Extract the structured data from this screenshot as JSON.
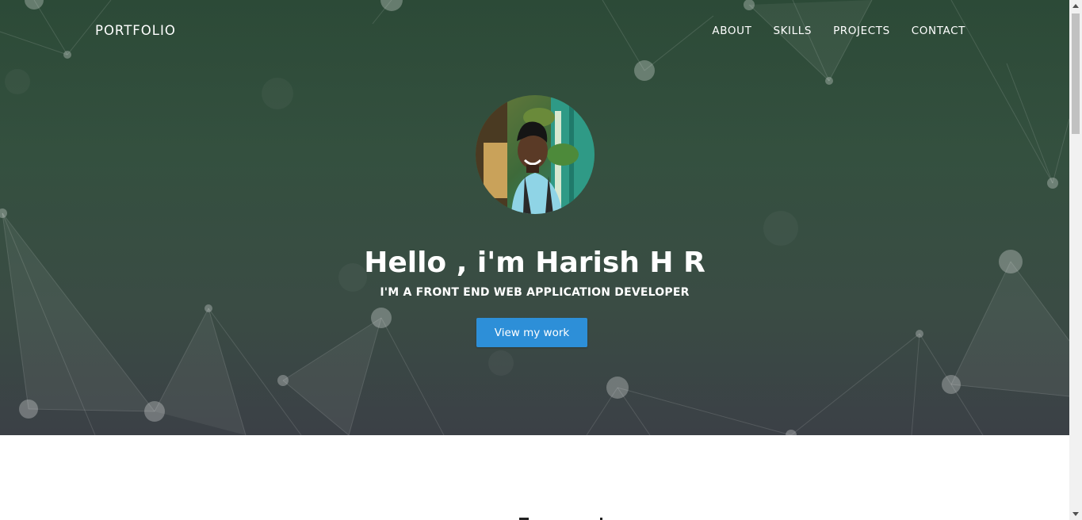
{
  "nav": {
    "brand": "PORTFOLIO",
    "links": [
      "ABOUT",
      "SKILLS",
      "PROJECTS",
      "CONTACT"
    ]
  },
  "hero": {
    "title": "Hello , i'm Harish H R",
    "subtitle": "I'M A FRONT END WEB APPLICATION DEVELOPER",
    "cta_label": "View my work",
    "avatar_icon": "profile-photo"
  },
  "colors": {
    "accent": "#2d8fd8",
    "hero_top": "#2c4a37",
    "hero_bottom": "#3b4046"
  }
}
